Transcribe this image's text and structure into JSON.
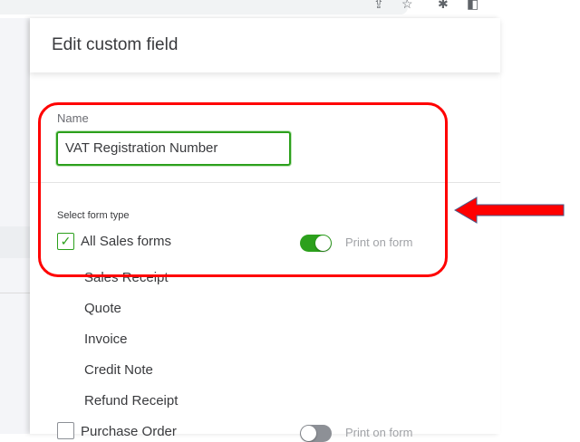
{
  "browser": {
    "icons": [
      "share-icon",
      "star-icon",
      "extensions-icon",
      "sidepanel-icon"
    ]
  },
  "dialog": {
    "title": "Edit custom field",
    "name_label": "Name",
    "name_value": "VAT Registration Number",
    "form_type_label": "Select form type",
    "all_sales": {
      "label": "All Sales forms",
      "checked": true,
      "print_label": "Print on form",
      "print_on": true
    },
    "sales_forms": [
      "Sales Receipt",
      "Quote",
      "Invoice",
      "Credit Note",
      "Refund Receipt"
    ],
    "purchase": {
      "label": "Purchase Order",
      "checked": false,
      "print_label": "Print on form",
      "print_on": false
    }
  },
  "colors": {
    "accent": "#2ca01c",
    "annotation": "#ff0000"
  }
}
